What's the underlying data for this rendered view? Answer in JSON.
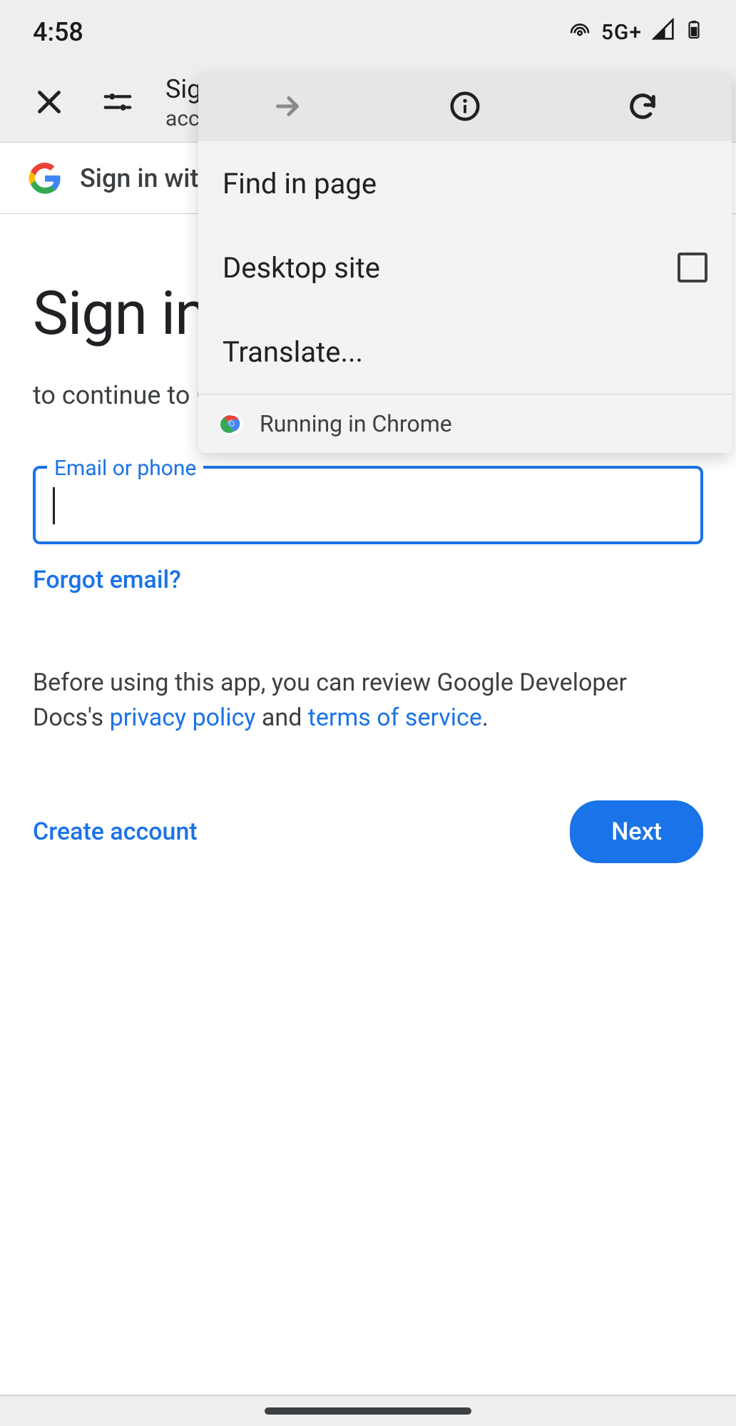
{
  "status": {
    "time": "4:58",
    "signal": "5G+"
  },
  "header": {
    "title": "Sign in",
    "subtitle": "accounts."
  },
  "banner": {
    "text": "Sign in with Google"
  },
  "menu": {
    "find": "Find in page",
    "desktop": "Desktop site",
    "translate": "Translate...",
    "footer": "Running in Chrome"
  },
  "page": {
    "heading": "Sign in",
    "continue_pre": "to continue to ",
    "continue_link": "Google Developer Docs",
    "field_label": "Email or phone",
    "email_value": "",
    "forgot": "Forgot email?",
    "legal_pre": "Before using this app, you can review Google Developer Docs's ",
    "privacy": "privacy policy",
    "legal_mid": " and ",
    "tos": "terms of service",
    "legal_end": ".",
    "create": "Create account",
    "next": "Next"
  }
}
